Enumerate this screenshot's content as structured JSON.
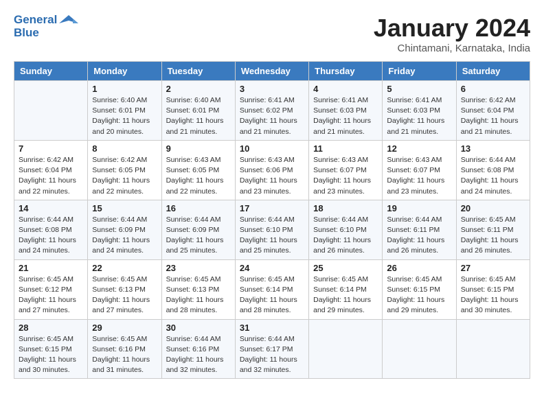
{
  "header": {
    "logo_line1": "General",
    "logo_line2": "Blue",
    "month": "January 2024",
    "location": "Chintamani, Karnataka, India"
  },
  "columns": [
    "Sunday",
    "Monday",
    "Tuesday",
    "Wednesday",
    "Thursday",
    "Friday",
    "Saturday"
  ],
  "weeks": [
    [
      {
        "day": "",
        "sunrise": "",
        "sunset": "",
        "daylight": ""
      },
      {
        "day": "1",
        "sunrise": "Sunrise: 6:40 AM",
        "sunset": "Sunset: 6:01 PM",
        "daylight": "Daylight: 11 hours and 20 minutes."
      },
      {
        "day": "2",
        "sunrise": "Sunrise: 6:40 AM",
        "sunset": "Sunset: 6:01 PM",
        "daylight": "Daylight: 11 hours and 21 minutes."
      },
      {
        "day": "3",
        "sunrise": "Sunrise: 6:41 AM",
        "sunset": "Sunset: 6:02 PM",
        "daylight": "Daylight: 11 hours and 21 minutes."
      },
      {
        "day": "4",
        "sunrise": "Sunrise: 6:41 AM",
        "sunset": "Sunset: 6:03 PM",
        "daylight": "Daylight: 11 hours and 21 minutes."
      },
      {
        "day": "5",
        "sunrise": "Sunrise: 6:41 AM",
        "sunset": "Sunset: 6:03 PM",
        "daylight": "Daylight: 11 hours and 21 minutes."
      },
      {
        "day": "6",
        "sunrise": "Sunrise: 6:42 AM",
        "sunset": "Sunset: 6:04 PM",
        "daylight": "Daylight: 11 hours and 21 minutes."
      }
    ],
    [
      {
        "day": "7",
        "sunrise": "Sunrise: 6:42 AM",
        "sunset": "Sunset: 6:04 PM",
        "daylight": "Daylight: 11 hours and 22 minutes."
      },
      {
        "day": "8",
        "sunrise": "Sunrise: 6:42 AM",
        "sunset": "Sunset: 6:05 PM",
        "daylight": "Daylight: 11 hours and 22 minutes."
      },
      {
        "day": "9",
        "sunrise": "Sunrise: 6:43 AM",
        "sunset": "Sunset: 6:05 PM",
        "daylight": "Daylight: 11 hours and 22 minutes."
      },
      {
        "day": "10",
        "sunrise": "Sunrise: 6:43 AM",
        "sunset": "Sunset: 6:06 PM",
        "daylight": "Daylight: 11 hours and 23 minutes."
      },
      {
        "day": "11",
        "sunrise": "Sunrise: 6:43 AM",
        "sunset": "Sunset: 6:07 PM",
        "daylight": "Daylight: 11 hours and 23 minutes."
      },
      {
        "day": "12",
        "sunrise": "Sunrise: 6:43 AM",
        "sunset": "Sunset: 6:07 PM",
        "daylight": "Daylight: 11 hours and 23 minutes."
      },
      {
        "day": "13",
        "sunrise": "Sunrise: 6:44 AM",
        "sunset": "Sunset: 6:08 PM",
        "daylight": "Daylight: 11 hours and 24 minutes."
      }
    ],
    [
      {
        "day": "14",
        "sunrise": "Sunrise: 6:44 AM",
        "sunset": "Sunset: 6:08 PM",
        "daylight": "Daylight: 11 hours and 24 minutes."
      },
      {
        "day": "15",
        "sunrise": "Sunrise: 6:44 AM",
        "sunset": "Sunset: 6:09 PM",
        "daylight": "Daylight: 11 hours and 24 minutes."
      },
      {
        "day": "16",
        "sunrise": "Sunrise: 6:44 AM",
        "sunset": "Sunset: 6:09 PM",
        "daylight": "Daylight: 11 hours and 25 minutes."
      },
      {
        "day": "17",
        "sunrise": "Sunrise: 6:44 AM",
        "sunset": "Sunset: 6:10 PM",
        "daylight": "Daylight: 11 hours and 25 minutes."
      },
      {
        "day": "18",
        "sunrise": "Sunrise: 6:44 AM",
        "sunset": "Sunset: 6:10 PM",
        "daylight": "Daylight: 11 hours and 26 minutes."
      },
      {
        "day": "19",
        "sunrise": "Sunrise: 6:44 AM",
        "sunset": "Sunset: 6:11 PM",
        "daylight": "Daylight: 11 hours and 26 minutes."
      },
      {
        "day": "20",
        "sunrise": "Sunrise: 6:45 AM",
        "sunset": "Sunset: 6:11 PM",
        "daylight": "Daylight: 11 hours and 26 minutes."
      }
    ],
    [
      {
        "day": "21",
        "sunrise": "Sunrise: 6:45 AM",
        "sunset": "Sunset: 6:12 PM",
        "daylight": "Daylight: 11 hours and 27 minutes."
      },
      {
        "day": "22",
        "sunrise": "Sunrise: 6:45 AM",
        "sunset": "Sunset: 6:13 PM",
        "daylight": "Daylight: 11 hours and 27 minutes."
      },
      {
        "day": "23",
        "sunrise": "Sunrise: 6:45 AM",
        "sunset": "Sunset: 6:13 PM",
        "daylight": "Daylight: 11 hours and 28 minutes."
      },
      {
        "day": "24",
        "sunrise": "Sunrise: 6:45 AM",
        "sunset": "Sunset: 6:14 PM",
        "daylight": "Daylight: 11 hours and 28 minutes."
      },
      {
        "day": "25",
        "sunrise": "Sunrise: 6:45 AM",
        "sunset": "Sunset: 6:14 PM",
        "daylight": "Daylight: 11 hours and 29 minutes."
      },
      {
        "day": "26",
        "sunrise": "Sunrise: 6:45 AM",
        "sunset": "Sunset: 6:15 PM",
        "daylight": "Daylight: 11 hours and 29 minutes."
      },
      {
        "day": "27",
        "sunrise": "Sunrise: 6:45 AM",
        "sunset": "Sunset: 6:15 PM",
        "daylight": "Daylight: 11 hours and 30 minutes."
      }
    ],
    [
      {
        "day": "28",
        "sunrise": "Sunrise: 6:45 AM",
        "sunset": "Sunset: 6:15 PM",
        "daylight": "Daylight: 11 hours and 30 minutes."
      },
      {
        "day": "29",
        "sunrise": "Sunrise: 6:45 AM",
        "sunset": "Sunset: 6:16 PM",
        "daylight": "Daylight: 11 hours and 31 minutes."
      },
      {
        "day": "30",
        "sunrise": "Sunrise: 6:44 AM",
        "sunset": "Sunset: 6:16 PM",
        "daylight": "Daylight: 11 hours and 32 minutes."
      },
      {
        "day": "31",
        "sunrise": "Sunrise: 6:44 AM",
        "sunset": "Sunset: 6:17 PM",
        "daylight": "Daylight: 11 hours and 32 minutes."
      },
      {
        "day": "",
        "sunrise": "",
        "sunset": "",
        "daylight": ""
      },
      {
        "day": "",
        "sunrise": "",
        "sunset": "",
        "daylight": ""
      },
      {
        "day": "",
        "sunrise": "",
        "sunset": "",
        "daylight": ""
      }
    ]
  ]
}
